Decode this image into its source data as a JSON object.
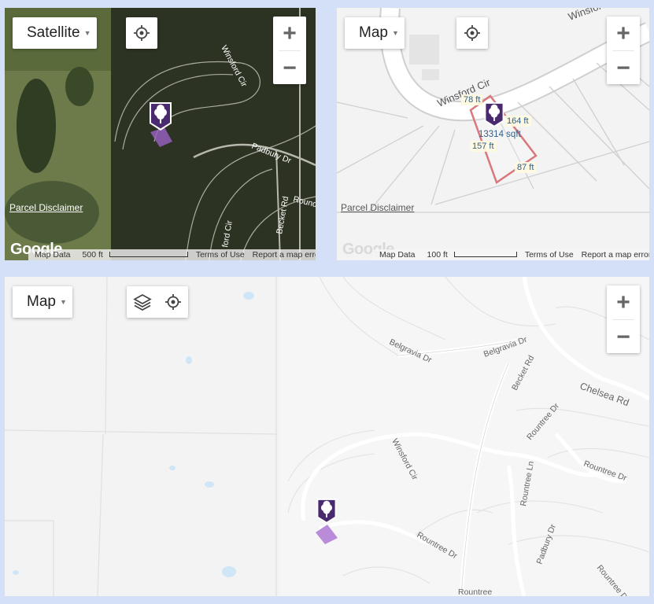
{
  "colors": {
    "marker": "#4a2a6e",
    "parcel_fill": "#a877c9",
    "parcel_outline": "#d9787c",
    "label_blue": "#2f5f8a"
  },
  "panels": [
    {
      "map_type_label": "Satellite",
      "disclaimer": "Parcel Disclaimer",
      "attribution": "Map Data",
      "scale": "500 ft",
      "terms": "Terms of Use",
      "report": "Report a map error",
      "logo": "Google",
      "road_labels": [
        "Winsford Cir",
        "Padbury Dr",
        "Becket Rd",
        "Round",
        "ford Cir"
      ]
    },
    {
      "map_type_label": "Map",
      "disclaimer": "Parcel Disclaimer",
      "attribution": "Map Data",
      "scale": "100 ft",
      "terms": "Terms of Use",
      "report": "Report a map error",
      "logo": "Google",
      "road_labels": [
        "Winsford Cir",
        "Winsford"
      ],
      "measurements": {
        "top": "78 ft",
        "right": "164 ft",
        "left": "157 ft",
        "bottom": "87 ft",
        "area": "13314 sqft"
      }
    },
    {
      "map_type_label": "Map",
      "road_labels": [
        "Belgravia Dr",
        "Belgravia Dr",
        "Becket Rd",
        "Chelsea Rd",
        "Winsford Cir",
        "Rountree Dr",
        "Rountree Ln",
        "Rountree Dr",
        "Rountree Dr",
        "Padbury Dr",
        "Rountree",
        "Roundtr",
        "Roundtr",
        "Rountree Dr"
      ]
    }
  ],
  "icons": [
    "locate-icon",
    "layers-icon",
    "zoom-in-icon",
    "zoom-out-icon",
    "tree-marker-icon",
    "dropdown-caret-icon"
  ],
  "zoom": {
    "in": "+",
    "out": "−"
  }
}
